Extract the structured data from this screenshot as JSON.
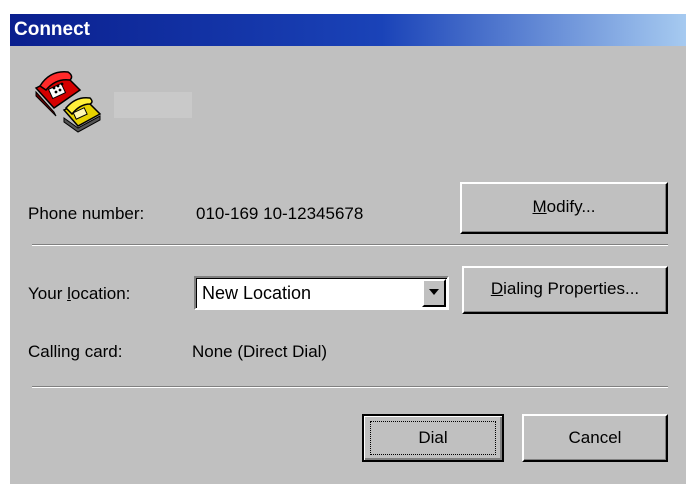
{
  "window": {
    "title": "Connect"
  },
  "connection": {
    "icon": "telephone-icon"
  },
  "phone": {
    "label_pre": "Phone number:",
    "value": "010-169 10-12345678",
    "modify_pre": "",
    "modify_accel": "M",
    "modify_post": "odify..."
  },
  "location": {
    "label_pre": "Your ",
    "label_accel": "l",
    "label_post": "ocation:",
    "selected": "New Location",
    "dialing_pre": "",
    "dialing_accel": "D",
    "dialing_post": "ialing Properties..."
  },
  "calling_card": {
    "label": "Calling card:",
    "value": "None (Direct Dial)"
  },
  "actions": {
    "dial_label": "Dial",
    "cancel_label": "Cancel"
  },
  "colors": {
    "title_start": "#0a1f8e",
    "title_end": "#a6caf0",
    "face": "#c0c0c0"
  }
}
